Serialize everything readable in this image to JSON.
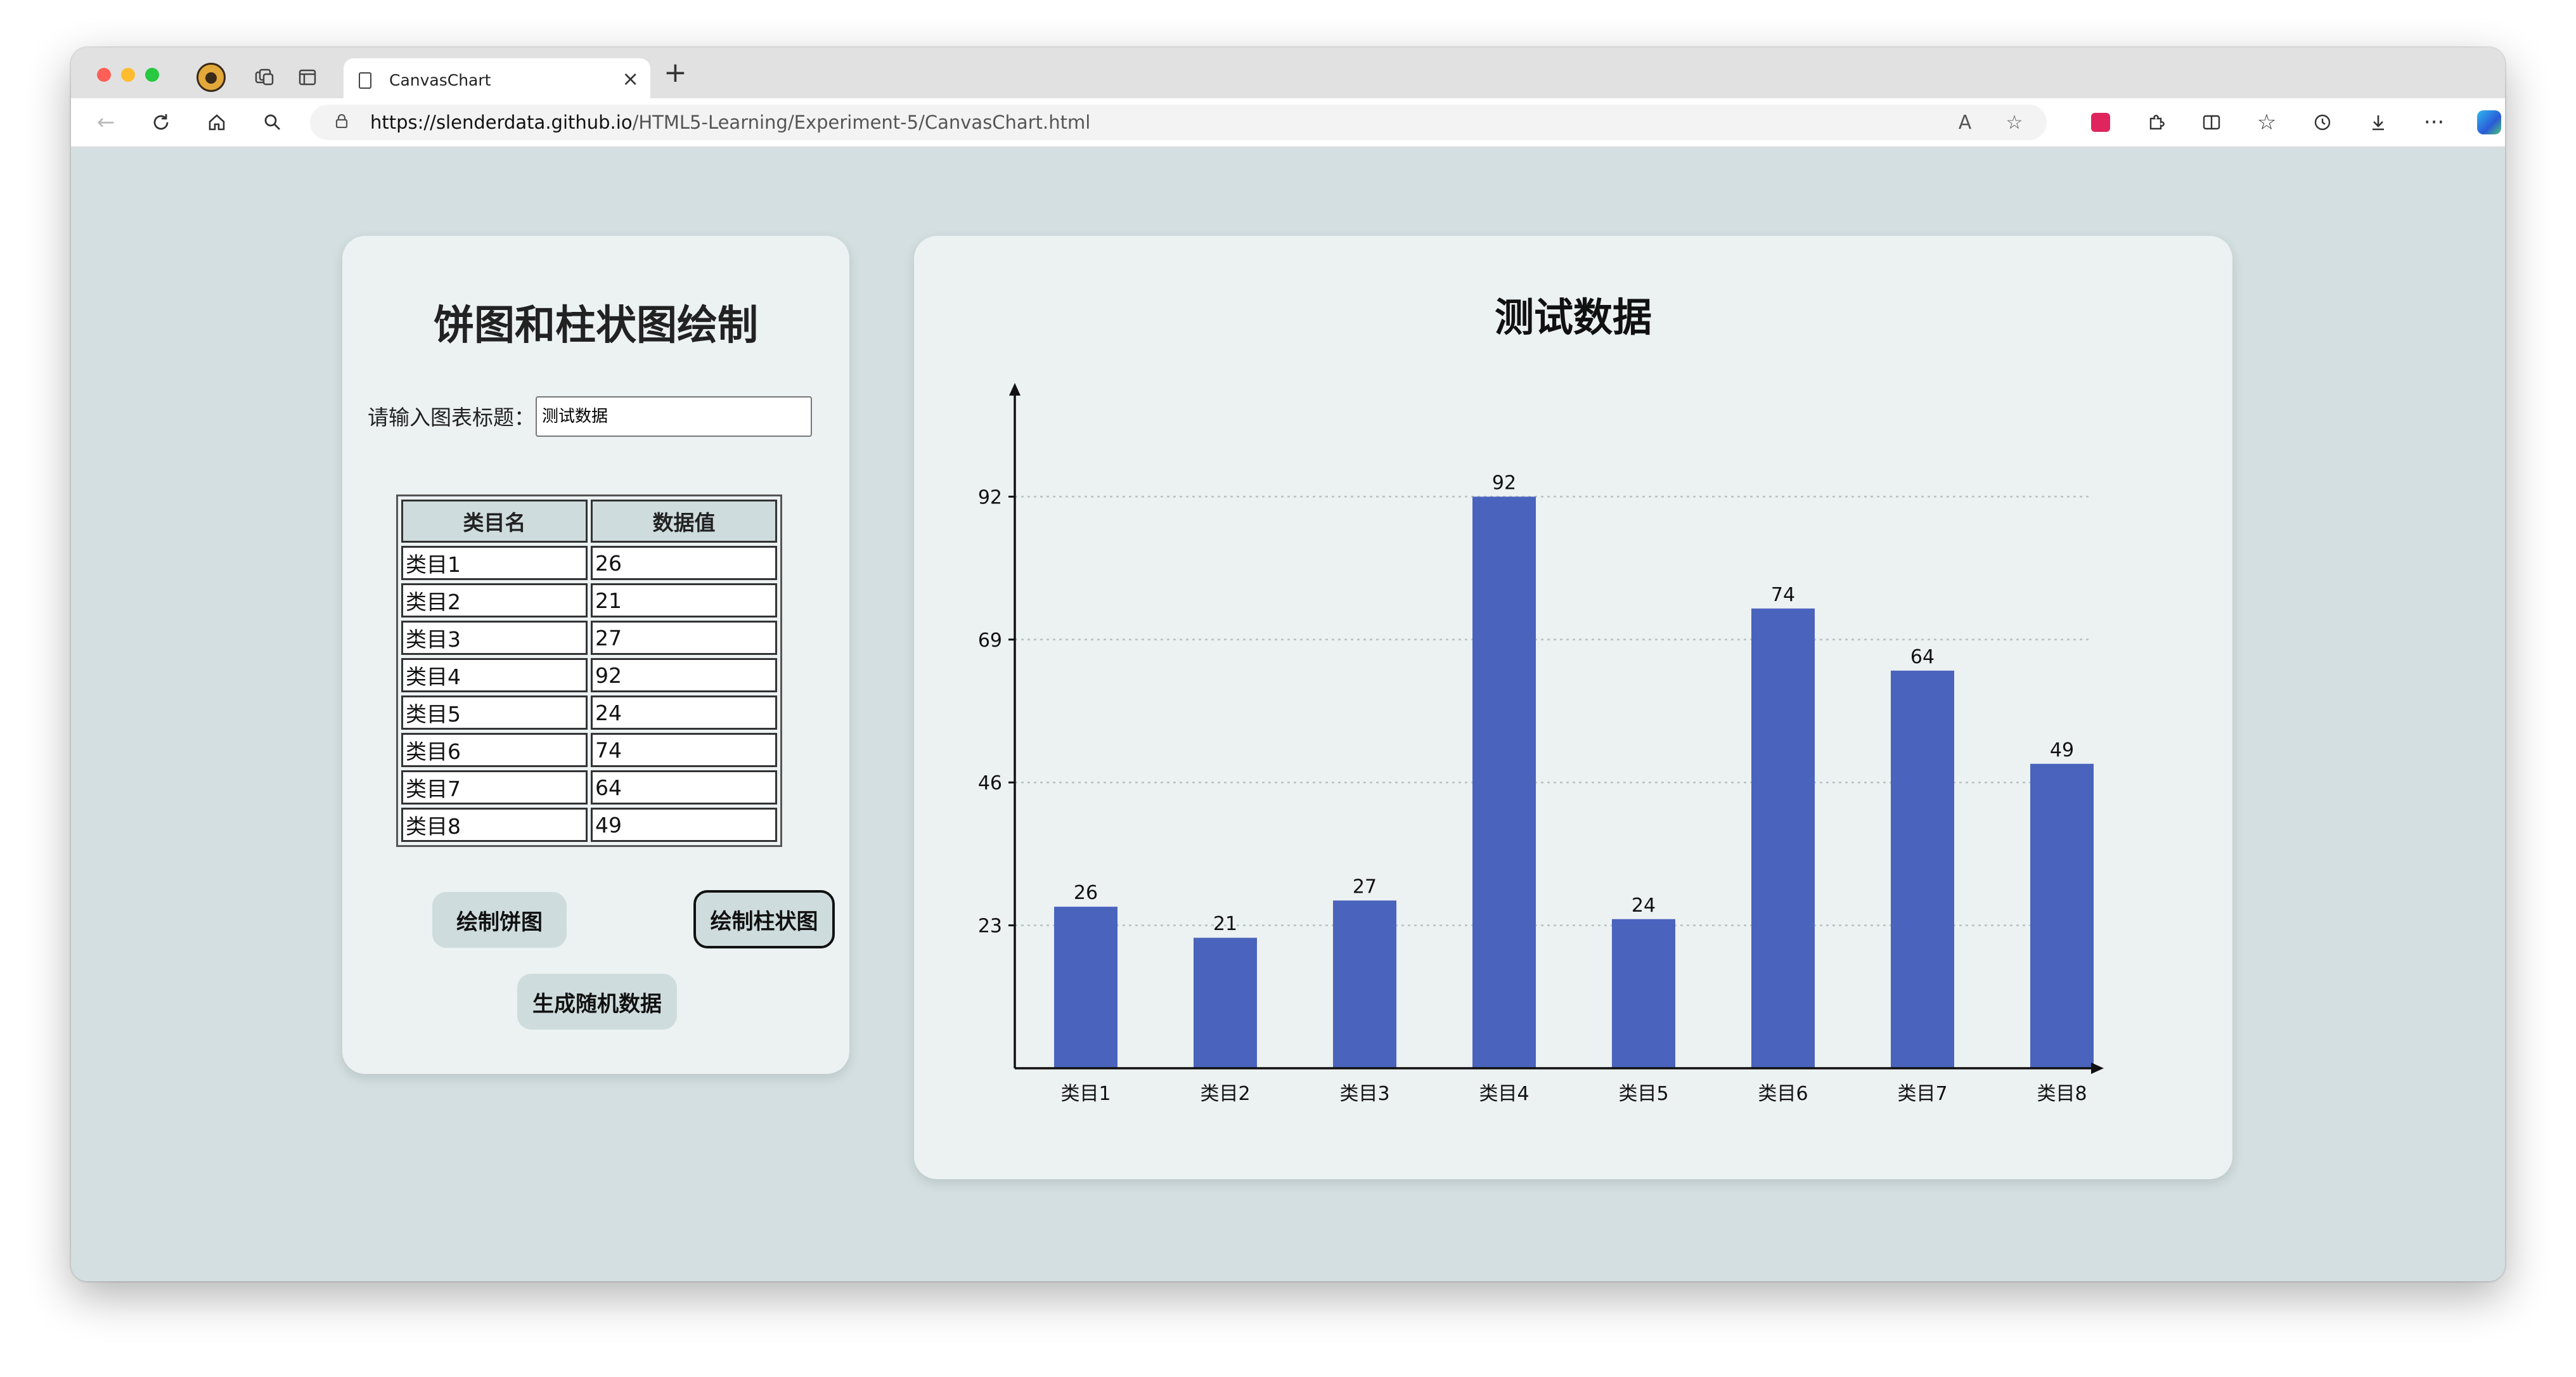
{
  "browser": {
    "tab_title": "CanvasChart",
    "url_host": "https://slenderdata.github.io",
    "url_path": "/HTML5-Learning/Experiment-5/CanvasChart.html"
  },
  "form": {
    "heading": "饼图和柱状图绘制",
    "title_label": "请输入图表标题：",
    "title_value": "测试数据",
    "col_name": "类目名",
    "col_value": "数据值",
    "rows": [
      {
        "name": "类目1",
        "value": "26"
      },
      {
        "name": "类目2",
        "value": "21"
      },
      {
        "name": "类目3",
        "value": "27"
      },
      {
        "name": "类目4",
        "value": "92"
      },
      {
        "name": "类目5",
        "value": "24"
      },
      {
        "name": "类目6",
        "value": "74"
      },
      {
        "name": "类目7",
        "value": "64"
      },
      {
        "name": "类目8",
        "value": "49"
      }
    ],
    "pie_button": "绘制饼图",
    "bar_button": "绘制柱状图",
    "random_button": "生成随机数据"
  },
  "chart_data": {
    "type": "bar",
    "title": "测试数据",
    "categories": [
      "类目1",
      "类目2",
      "类目3",
      "类目4",
      "类目5",
      "类目6",
      "类目7",
      "类目8"
    ],
    "values": [
      26,
      21,
      27,
      92,
      24,
      74,
      64,
      49
    ],
    "yticks": [
      23,
      46,
      69,
      92
    ],
    "ylim": [
      0,
      92
    ],
    "grid": true,
    "bar_color": "#4a63bd",
    "xlabel": "",
    "ylabel": ""
  }
}
